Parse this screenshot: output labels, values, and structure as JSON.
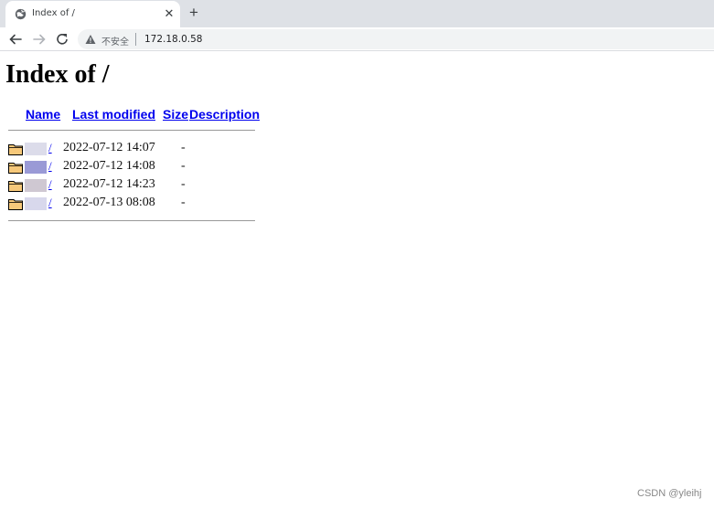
{
  "browser": {
    "tab_title": "Index of /",
    "tab_close_glyph": "✕",
    "new_tab_glyph": "+",
    "security_label": "不安全",
    "url": "172.18.0.58"
  },
  "page": {
    "heading": "Index of /",
    "columns": {
      "name": "Name",
      "last_modified": "Last modified",
      "size": "Size",
      "description": "Description"
    },
    "rows": [
      {
        "name_suffix": "/",
        "modified": "2022-07-12 14:07",
        "size": "-",
        "description": ""
      },
      {
        "name_suffix": "/",
        "modified": "2022-07-12 14:08",
        "size": "-",
        "description": ""
      },
      {
        "name_suffix": "/",
        "modified": "2022-07-12 14:23",
        "size": "-",
        "description": ""
      },
      {
        "name_suffix": "/",
        "modified": "2022-07-13 08:08",
        "size": "-",
        "description": ""
      }
    ]
  },
  "watermark": "CSDN @yleihj",
  "icons": {
    "favicon": "globe-icon",
    "back": "arrow-left-icon",
    "forward": "arrow-right-icon",
    "reload": "reload-icon",
    "security": "warning-triangle-icon",
    "folder": "folder-icon"
  },
  "colors": {
    "link": "#0000ee",
    "tabbar": "#dee1e6",
    "omnibox": "#f1f3f4",
    "folder": "#f6c87a"
  }
}
